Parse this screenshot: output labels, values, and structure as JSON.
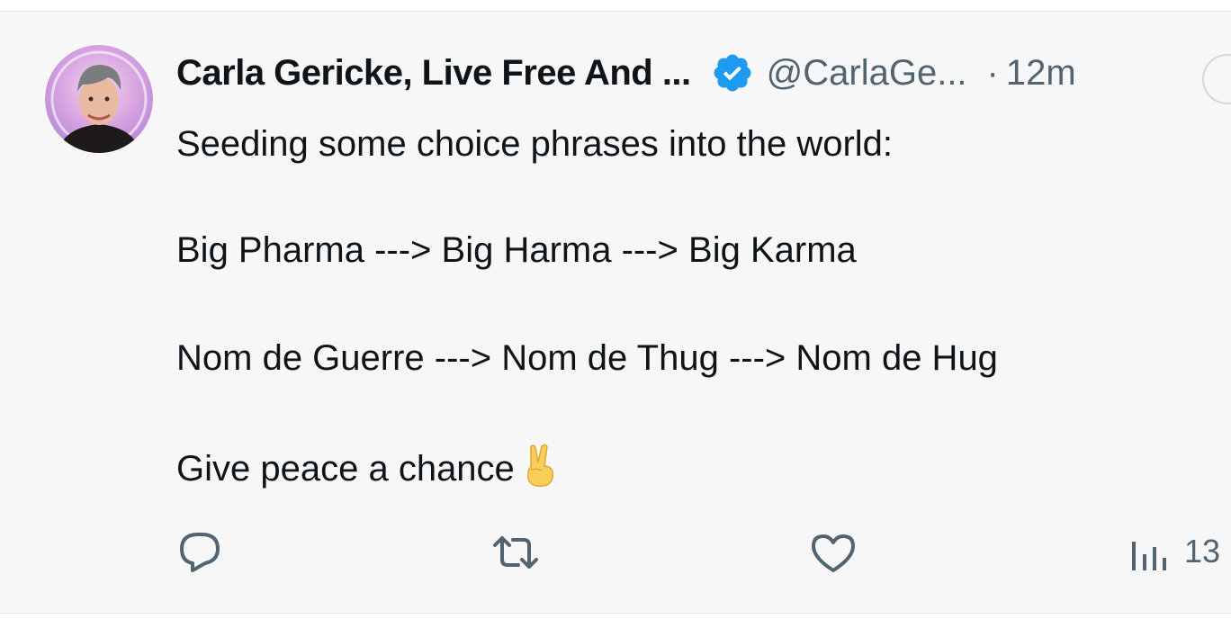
{
  "post": {
    "author_name": "Carla Gericke, Live Free And ...",
    "handle": "@CarlaGe...",
    "separator": "·",
    "time": "12m",
    "lines": [
      "Seeding some choice phrases into the world:",
      "Big Pharma ---> Big Harma ---> Big Karma",
      "Nom de Guerre ---> Nom de Thug ---> Nom de Hug",
      "Give peace a chance"
    ],
    "emoji": "victory-hand",
    "views": "13"
  },
  "icons": [
    "avatar",
    "verified-badge-icon",
    "reply-icon",
    "retweet-icon",
    "like-icon",
    "views-icon",
    "victory-hand-icon"
  ],
  "colors": {
    "background": "#f7f7f7",
    "text": "#0f1419",
    "muted": "#536471",
    "verified": "#1d9bf0"
  }
}
